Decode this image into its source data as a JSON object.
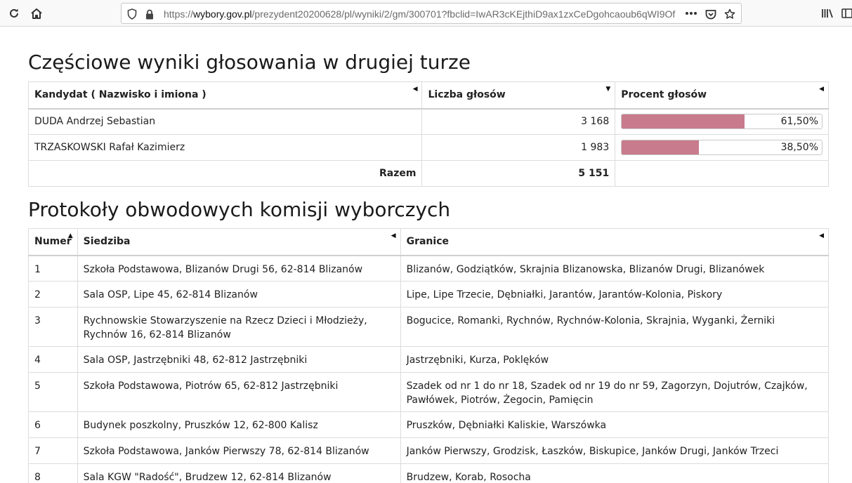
{
  "browser": {
    "url_prefix": "https://",
    "url_domain": "wybory.gov.pl",
    "url_path": "/prezydent20200628/pl/wyniki/2/gm/300701?fbclid=IwAR3cKEjthiD9ax1zxCeDgohcaoub6qWI9Of"
  },
  "results": {
    "title": "Częściowe wyniki głosowania w drugiej turze",
    "headers": {
      "candidate": "Kandydat ( Nazwisko i imiona )",
      "votes": "Liczba głosów",
      "percent": "Procent głosów"
    },
    "rows": [
      {
        "name": "DUDA Andrzej Sebastian",
        "votes": "3 168",
        "percent": "61,50%",
        "fraction": 0.615
      },
      {
        "name": "TRZASKOWSKI Rafał Kazimierz",
        "votes": "1 983",
        "percent": "38,50%",
        "fraction": 0.385
      }
    ],
    "total_label": "Razem",
    "total_votes": "5 151",
    "bar_color": "#c87b8c"
  },
  "protocols": {
    "title": "Protokoły obwodowych komisji wyborczych",
    "headers": {
      "number": "Numer",
      "seat": "Siedziba",
      "bounds": "Granice"
    },
    "rows": [
      {
        "n": "1",
        "seat": "Szkoła Podstawowa, Blizanów Drugi 56, 62-814 Blizanów",
        "bounds": "Blizanów, Godziątków, Skrajnia Blizanowska, Blizanów Drugi, Blizanówek"
      },
      {
        "n": "2",
        "seat": "Sala OSP, Lipe 45, 62-814 Blizanów",
        "bounds": "Lipe, Lipe Trzecie, Dębniałki, Jarantów, Jarantów-Kolonia, Piskory"
      },
      {
        "n": "3",
        "seat": "Rychnowskie Stowarzyszenie na Rzecz Dzieci i Młodzieży, Rychnów 16, 62-814 Blizanów",
        "bounds": "Bogucice, Romanki, Rychnów, Rychnów-Kolonia, Skrajnia, Wyganki, Żerniki"
      },
      {
        "n": "4",
        "seat": "Sala OSP, Jastrzębniki 48, 62-812 Jastrzębniki",
        "bounds": "Jastrzębniki, Kurza, Poklęków"
      },
      {
        "n": "5",
        "seat": "Szkoła Podstawowa, Piotrów 65, 62-812 Jastrzębniki",
        "bounds": "Szadek od nr 1 do nr 18, Szadek od nr 19 do nr 59, Zagorzyn, Dojutrów, Czajków, Pawłówek, Piotrów, Żegocin, Pamięcin"
      },
      {
        "n": "6",
        "seat": "Budynek poszkolny, Pruszków 12, 62-800 Kalisz",
        "bounds": "Pruszków, Dębniałki Kaliskie, Warszówka"
      },
      {
        "n": "7",
        "seat": "Szkoła Podstawowa, Janków Pierwszy 78, 62-814 Blizanów",
        "bounds": "Janków Pierwszy, Grodzisk, Łaszków, Biskupice, Janków Drugi, Janków Trzeci"
      },
      {
        "n": "8",
        "seat": "Sala KGW \"Radość\", Brudzew 12, 62-814 Blizanów",
        "bounds": "Brudzew, Korab, Rosocha"
      }
    ]
  }
}
